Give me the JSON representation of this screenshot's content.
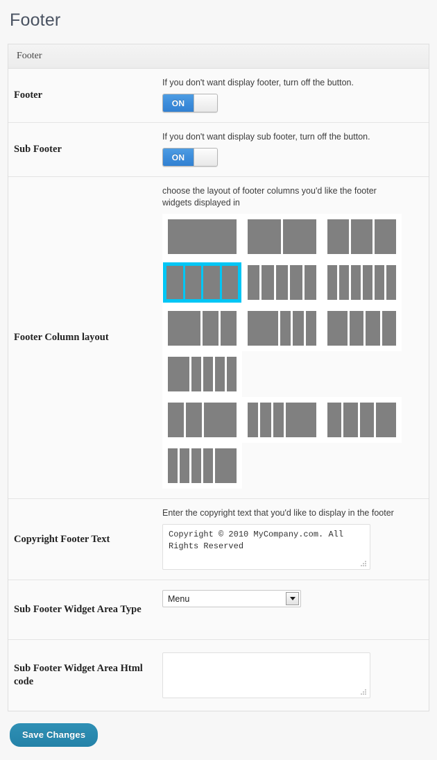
{
  "page": {
    "title": "Footer"
  },
  "panel": {
    "header": "Footer"
  },
  "rows": {
    "footer": {
      "label": "Footer",
      "hint": "If you don't want display footer, turn off the button.",
      "toggle_state": "ON"
    },
    "sub_footer": {
      "label": "Sub Footer",
      "hint": "If you don't want display sub footer, turn off the button.",
      "toggle_state": "ON"
    },
    "column_layout": {
      "label": "Footer Column layout",
      "hint": "choose the layout of footer columns you'd like the footer widgets displayed in",
      "selected_index": 3
    },
    "copyright": {
      "label": "Copyright Footer Text",
      "hint": "Enter the copyright text that you'd like to display in the footer",
      "value": "Copyright © 2010 MyCompany.com. All Rights Reserved"
    },
    "widget_area_type": {
      "label": "Sub Footer Widget Area Type",
      "value": "Menu",
      "options": [
        "Menu"
      ]
    },
    "widget_area_html": {
      "label": "Sub Footer Widget Area Html code",
      "value": ""
    }
  },
  "layout_options": [
    {
      "name": "one-column",
      "widths": [
        100
      ]
    },
    {
      "name": "two-columns",
      "widths": [
        50,
        50
      ]
    },
    {
      "name": "three-columns",
      "widths": [
        33.3,
        33.3,
        33.3
      ]
    },
    {
      "name": "four-columns",
      "widths": [
        25,
        25,
        25,
        25
      ]
    },
    {
      "name": "five-columns",
      "widths": [
        20,
        20,
        20,
        20,
        20
      ]
    },
    {
      "name": "six-columns",
      "widths": [
        16.6,
        16.6,
        16.6,
        16.6,
        16.6,
        16.6
      ]
    },
    {
      "name": "wide-left-two-narrow",
      "widths": [
        50,
        24,
        24
      ]
    },
    {
      "name": "wide-left-three-narrow",
      "widths": [
        46,
        16,
        16,
        16
      ]
    },
    {
      "name": "wide-left-three-equal",
      "widths": [
        31,
        22,
        22,
        22
      ]
    },
    {
      "name": "wide-left-four-narrow",
      "widths": [
        33,
        15,
        15,
        15,
        15
      ]
    },
    {
      "name": "two-narrow-wide-right",
      "widths": [
        24,
        24,
        50
      ]
    },
    {
      "name": "three-narrow-wide-right",
      "widths": [
        16,
        16,
        16,
        46
      ]
    },
    {
      "name": "three-equal-wide-right",
      "widths": [
        22,
        22,
        22,
        31
      ]
    },
    {
      "name": "four-narrow-wide-right",
      "widths": [
        15,
        15,
        15,
        15,
        33
      ]
    }
  ],
  "footer_actions": {
    "save_label": "Save Changes"
  },
  "colors": {
    "accent_selected": "#00c6f5",
    "toggle_on": "#3d8ddb",
    "save_button": "#2482a8",
    "layout_bar": "#808080"
  }
}
